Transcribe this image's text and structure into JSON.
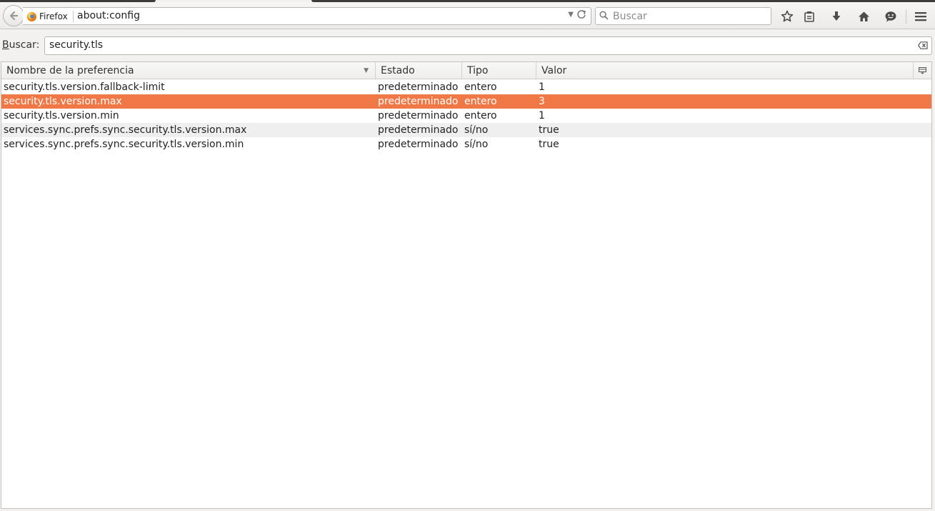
{
  "browser": {
    "identity_label": "Firefox",
    "url": "about:config",
    "search_placeholder": "Buscar"
  },
  "filter": {
    "label_accel": "B",
    "label_rest": "uscar:",
    "value": "security.tls"
  },
  "table": {
    "columns": {
      "name": "Nombre de la preferencia",
      "status": "Estado",
      "type": "Tipo",
      "value": "Valor"
    },
    "rows": [
      {
        "name": "security.tls.version.fallback-limit",
        "status": "predeterminado",
        "type": "entero",
        "value": "1"
      },
      {
        "name": "security.tls.version.max",
        "status": "predeterminado",
        "type": "entero",
        "value": "3"
      },
      {
        "name": "security.tls.version.min",
        "status": "predeterminado",
        "type": "entero",
        "value": "1"
      },
      {
        "name": "services.sync.prefs.sync.security.tls.version.max",
        "status": "predeterminado",
        "type": "sí/no",
        "value": "true"
      },
      {
        "name": "services.sync.prefs.sync.security.tls.version.min",
        "status": "predeterminado",
        "type": "sí/no",
        "value": "true"
      }
    ],
    "selected_row_index": 1
  },
  "colors": {
    "selection": "#f07746",
    "alt_row": "#efefef",
    "chrome_bg": "#f2f1f0"
  },
  "icons": {
    "back": "arrow-left-icon",
    "site": "firefox-icon",
    "url_dropdown": "chevron-down-icon",
    "reload": "reload-icon",
    "search": "search-icon",
    "bookmark": "star-icon",
    "reading_list": "clipboard-icon",
    "downloads": "download-arrow-icon",
    "home": "home-icon",
    "chat": "chat-icon",
    "menu": "hamburger-menu-icon",
    "clear_filter": "backspace-clear-icon",
    "column_picker": "column-picker-icon"
  }
}
